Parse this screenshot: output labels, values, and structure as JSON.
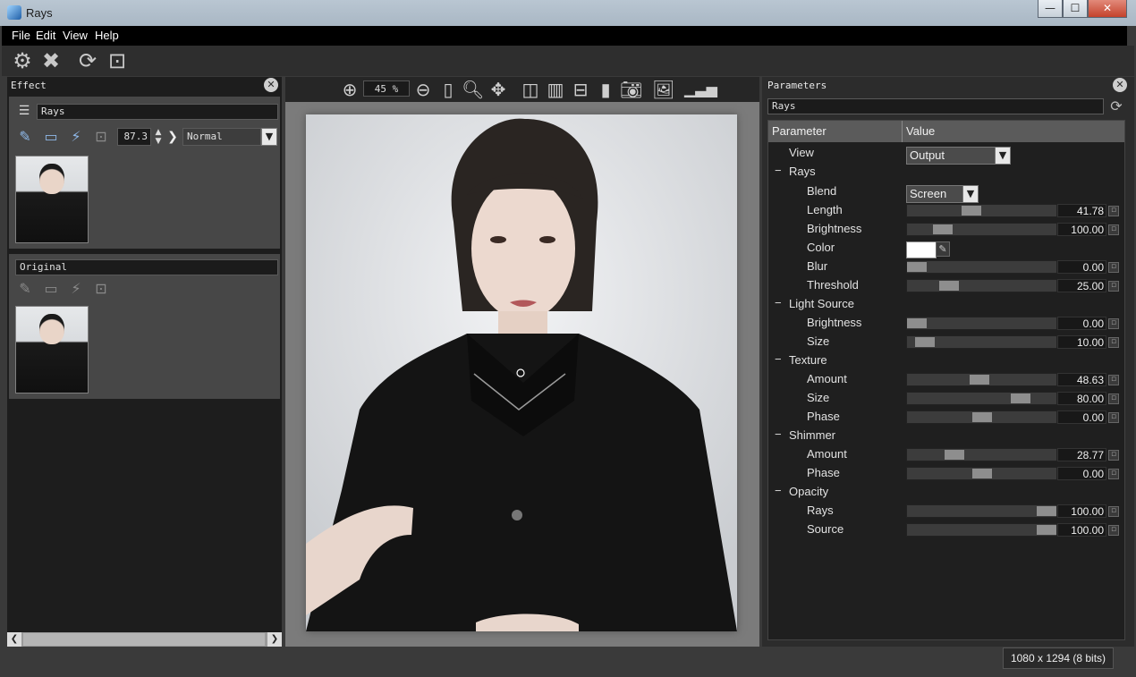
{
  "window": {
    "title": "Rays",
    "minimize": "—",
    "maximize": "☐",
    "close": "✕"
  },
  "menu": [
    "File",
    "Edit",
    "View",
    "Help"
  ],
  "toolbar": {
    "icons": [
      "gear-icon",
      "close-x-icon",
      "refresh-icon",
      "fit-frame-icon"
    ]
  },
  "effect_panel": {
    "title": "Effect",
    "effect_layer": {
      "name": "Rays",
      "opacity": "87.3",
      "blend_mode": "Normal"
    },
    "original_layer": {
      "name": "Original"
    }
  },
  "view": {
    "zoom": "45 %"
  },
  "parameters": {
    "title": "Parameters",
    "preset": "Rays",
    "col_param": "Parameter",
    "col_value": "Value",
    "view_label": "View",
    "view_value": "Output",
    "groups": {
      "rays": "Rays",
      "light_source": "Light Source",
      "texture": "Texture",
      "shimmer": "Shimmer",
      "opacity": "Opacity"
    },
    "blend_label": "Blend",
    "blend_value": "Screen",
    "color_label": "Color",
    "color_value": "#ffffff",
    "sliders": [
      {
        "label": "Length",
        "value": "41.78",
        "fraction": 0.418
      },
      {
        "label": "Brightness",
        "value": "100.00",
        "fraction": 0.2
      },
      {
        "label": "Blur",
        "value": "0.00",
        "fraction": 0.0
      },
      {
        "label": "Threshold",
        "value": "25.00",
        "fraction": 0.25
      },
      {
        "label": "Brightness",
        "value": "0.00",
        "fraction": 0.0
      },
      {
        "label": "Size",
        "value": "10.00",
        "fraction": 0.06
      },
      {
        "label": "Amount",
        "value": "48.63",
        "fraction": 0.486
      },
      {
        "label": "Size",
        "value": "80.00",
        "fraction": 0.8
      },
      {
        "label": "Phase",
        "value": "0.00",
        "fraction": 0.5
      },
      {
        "label": "Amount",
        "value": "28.77",
        "fraction": 0.288
      },
      {
        "label": "Phase",
        "value": "0.00",
        "fraction": 0.5
      },
      {
        "label": "Rays",
        "value": "100.00",
        "fraction": 1.0
      },
      {
        "label": "Source",
        "value": "100.00",
        "fraction": 1.0
      }
    ]
  },
  "status": {
    "image_info": "1080 x 1294 (8 bits)"
  }
}
